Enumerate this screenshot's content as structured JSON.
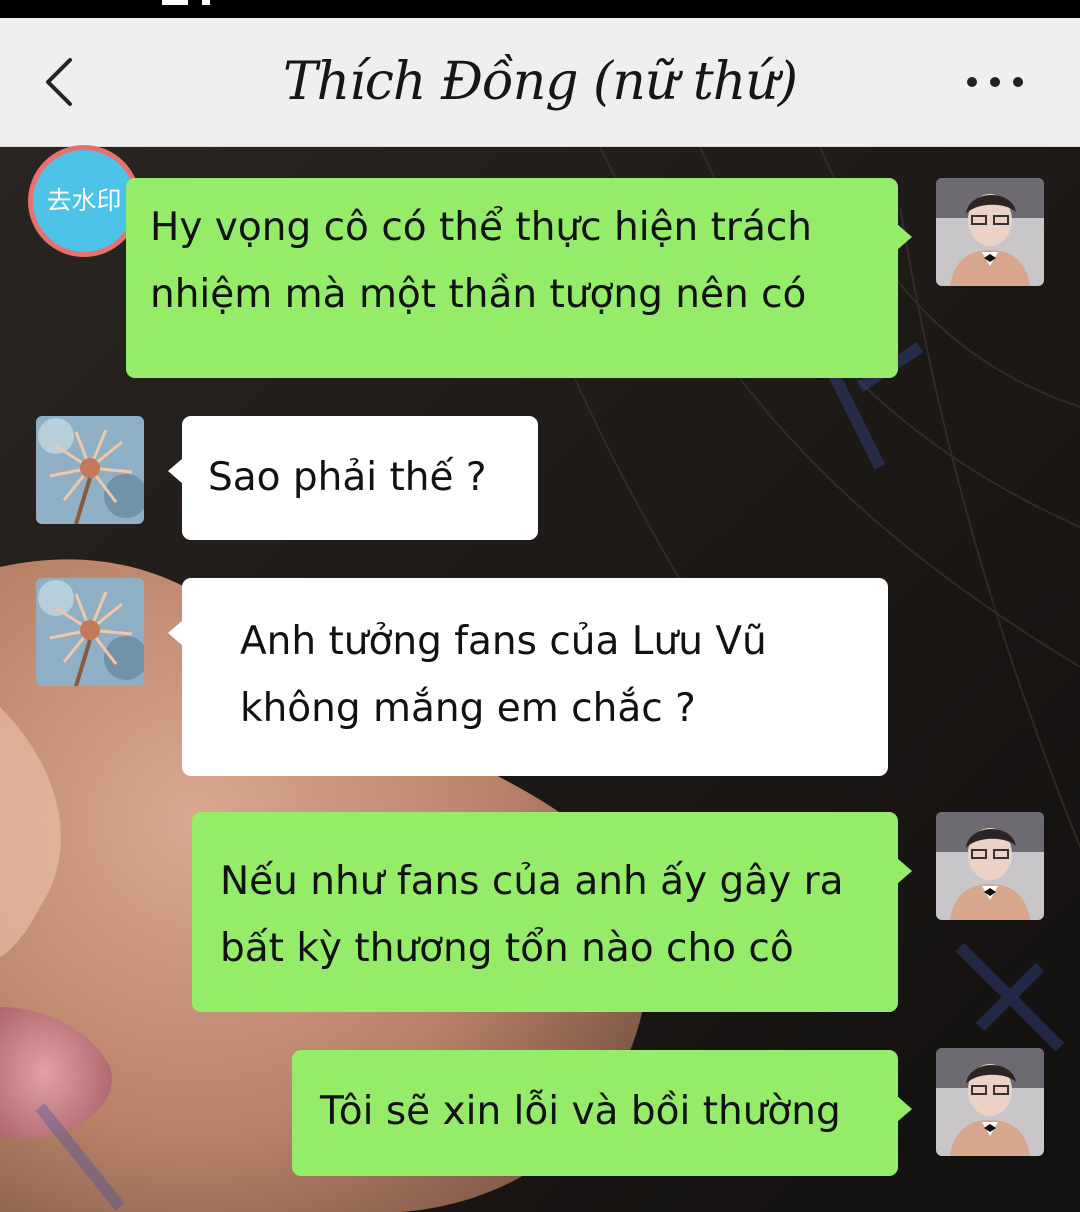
{
  "header": {
    "title": "Thích Đồng (nữ thứ)",
    "back_icon": "chevron-left-icon",
    "more_icon": "more-dots-icon"
  },
  "watermark_badge": {
    "text": "去水印"
  },
  "colors": {
    "header_bg": "#efefef",
    "sent_bubble": "#95ec69",
    "received_bubble": "#ffffff",
    "badge_bg": "#4dc3e8",
    "badge_border": "#e8716e"
  },
  "messages": [
    {
      "side": "right",
      "lines": [
        "Hy vọng cô có thể thực hiện trách",
        "nhiệm mà một thần tượng nên có"
      ]
    },
    {
      "side": "left",
      "lines": [
        "Sao phải thế ?"
      ]
    },
    {
      "side": "left",
      "lines": [
        "Anh tưởng fans của Lưu Vũ",
        "không mắng em chắc ?"
      ]
    },
    {
      "side": "right",
      "lines": [
        "Nếu như fans của anh ấy gây ra",
        "bất kỳ thương tổn nào cho cô"
      ]
    },
    {
      "side": "right",
      "lines": [
        "Tôi sẽ xin lỗi và bồi thường"
      ]
    }
  ]
}
